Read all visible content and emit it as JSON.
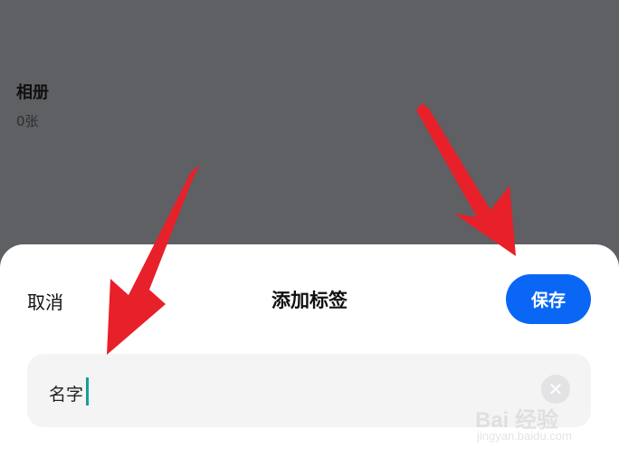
{
  "background": {
    "album": {
      "title": "相册",
      "count": "0张"
    }
  },
  "sheet": {
    "cancel_label": "取消",
    "title": "添加标签",
    "save_label": "保存",
    "input_value": "名字",
    "clear_icon": "close-icon"
  },
  "colors": {
    "accent": "#0a67f5",
    "caret": "#14a098",
    "annotation_arrow": "#e8202a",
    "overlay": "#5f6063"
  },
  "watermark": {
    "line1": "Bai 经验",
    "line2": "jingyan.baidu.com"
  }
}
